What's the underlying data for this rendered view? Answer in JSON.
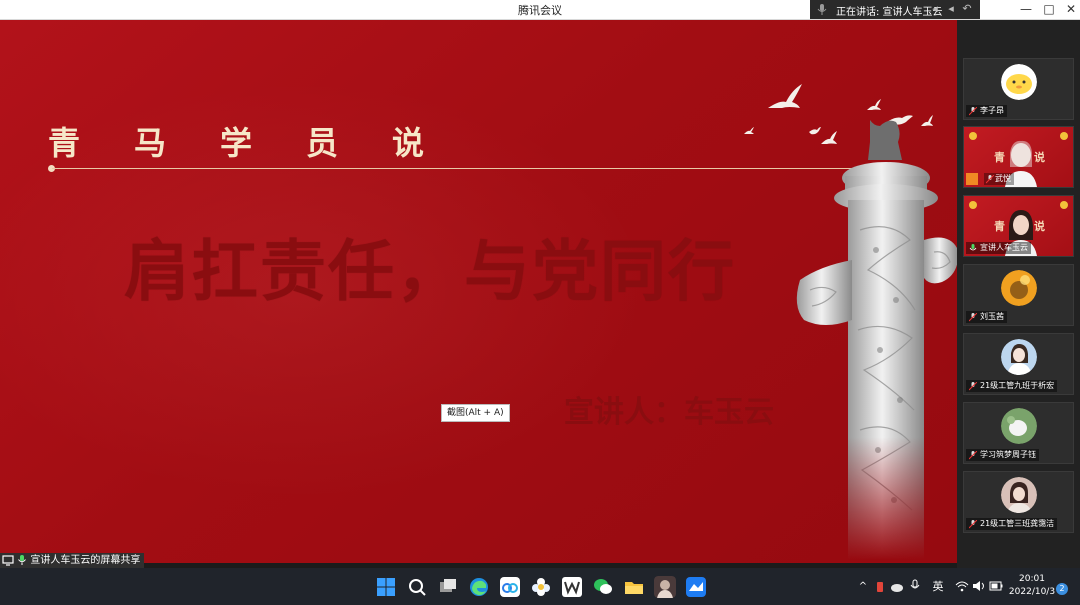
{
  "window": {
    "title": "腾讯会议",
    "speaking_label": "正在讲话: 宣讲人车玉云",
    "minimize_glyph": "—",
    "maximize_glyph": "□",
    "close_glyph": "✕"
  },
  "slide": {
    "heading_chars": [
      "青",
      "马",
      "学",
      "员",
      "说"
    ],
    "slogan": "肩扛责任，与党同行",
    "presenter": "宣讲人：车玉云"
  },
  "screenshot_tooltip": "截图(Alt + A)",
  "share_status": "宣讲人车玉云的屏幕共享",
  "participants": [
    {
      "name": "李子昂",
      "type": "avatar",
      "avatar_color": "#ffd84a"
    },
    {
      "name": "武悦",
      "type": "video",
      "video_text": "青",
      "video_text2": "说"
    },
    {
      "name": "宣讲人车玉云",
      "type": "video",
      "video_text": "青",
      "video_text2": "说"
    },
    {
      "name": "刘玉茜",
      "type": "avatar",
      "avatar_color": "#f0a020"
    },
    {
      "name": "21级工管九班于析宏",
      "type": "avatar",
      "avatar_color": "#bcd6ef"
    },
    {
      "name": "学习筑梦周子钰",
      "type": "avatar",
      "avatar_color": "#7aa36b"
    },
    {
      "name": "21级工管三班龚霭洁",
      "type": "avatar",
      "avatar_color": "#d8c0b8"
    }
  ],
  "taskbar": {
    "icons": [
      "windows-start-icon",
      "search-icon",
      "task-view-icon",
      "edge-icon",
      "baidu-netdisk-icon",
      "app-flower-icon",
      "wps-icon",
      "wechat-icon",
      "file-explorer-icon",
      "tencent-meeting-avatar-icon",
      "tencent-meeting-icon"
    ],
    "chevron": "^",
    "ime": "英",
    "time": "20:01",
    "date": "2022/10/3",
    "notification_count": "2"
  }
}
